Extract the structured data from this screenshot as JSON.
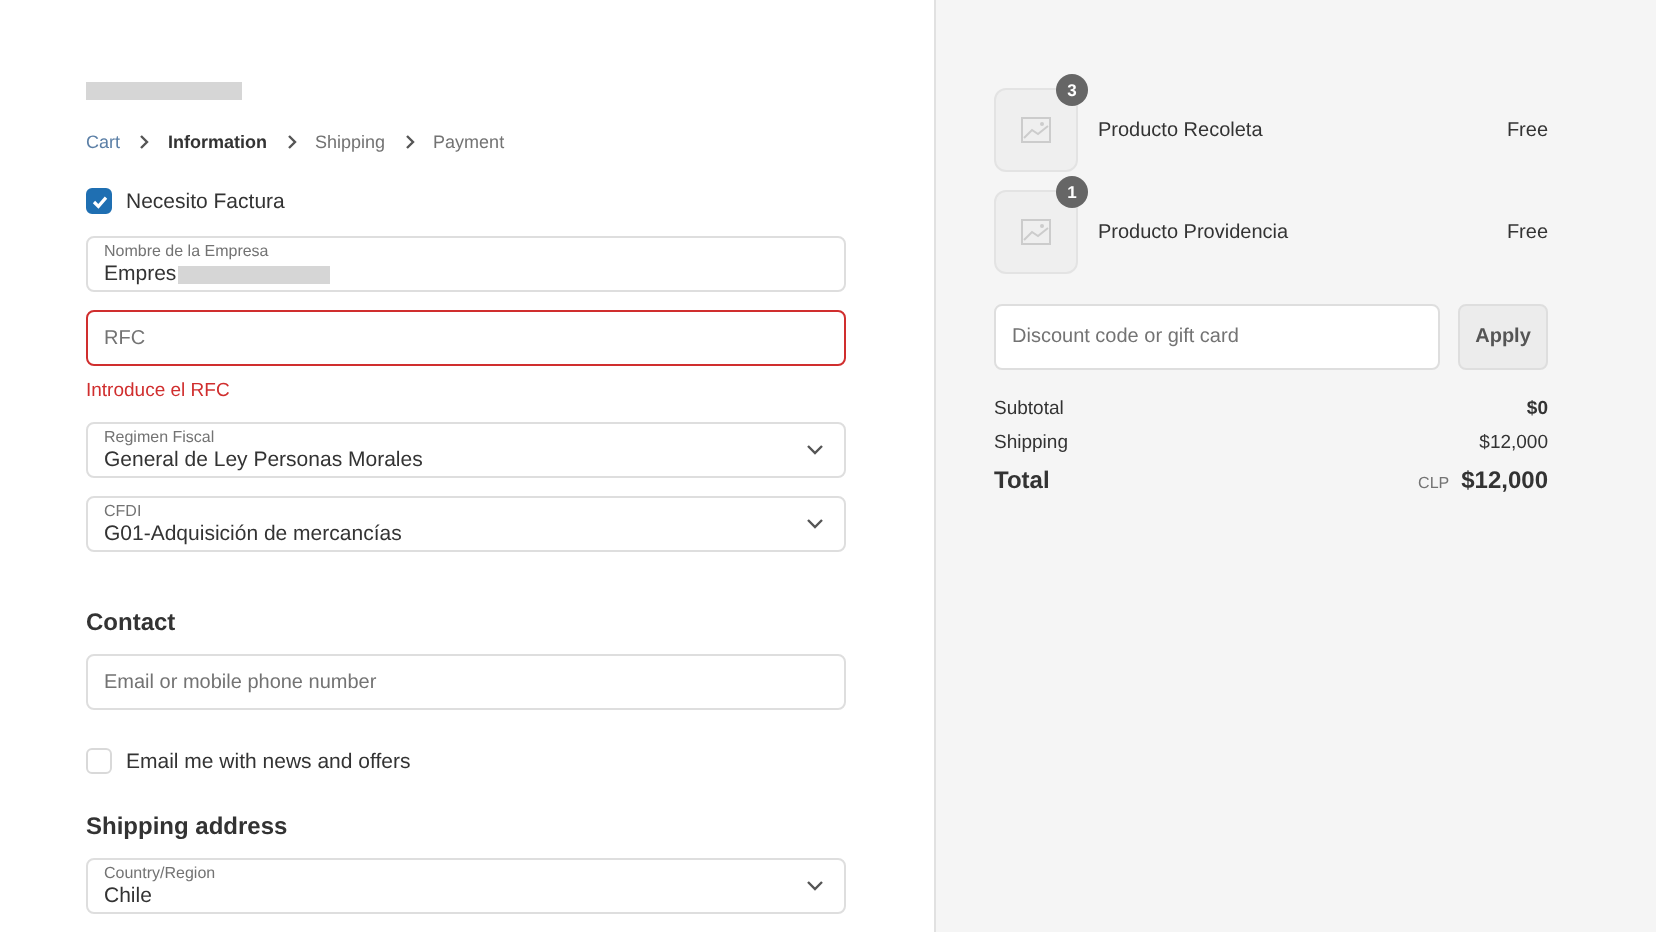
{
  "breadcrumb": [
    {
      "label": "Cart",
      "selected": false,
      "completed": true
    },
    {
      "label": "Information",
      "selected": true,
      "completed": false
    },
    {
      "label": "Shipping",
      "selected": false,
      "completed": false
    },
    {
      "label": "Payment",
      "selected": false,
      "completed": false
    }
  ],
  "invoice_checkbox": {
    "label": "Necesito Factura",
    "checked": true
  },
  "invoice_fields": [
    {
      "kind": "text",
      "label": "Nombre de la Empresa",
      "value": "Empres",
      "redacted": true,
      "invalid": false
    },
    {
      "kind": "text",
      "placeholder": "RFC",
      "invalid": true,
      "error": "Introduce el RFC"
    },
    {
      "kind": "select",
      "label": "Regimen Fiscal",
      "value": "General de Ley Personas Morales",
      "invalid": false
    },
    {
      "kind": "select",
      "label": "CFDI",
      "value": "G01-Adquisición de mercancías",
      "invalid": false
    }
  ],
  "contact": {
    "heading": "Contact",
    "field": {
      "placeholder": "Email or mobile phone number",
      "invalid": false
    },
    "newsletter": {
      "label": "Email me with news and offers",
      "checked": false
    }
  },
  "shipping_address": {
    "heading": "Shipping address",
    "field": {
      "kind": "select",
      "label": "Country/Region",
      "value": "Chile",
      "invalid": false
    }
  },
  "order_items": [
    {
      "name": "Producto Recoleta",
      "quantity": "3",
      "price": "Free"
    },
    {
      "name": "Producto Providencia",
      "quantity": "1",
      "price": "Free"
    }
  ],
  "discount": {
    "placeholder": "Discount code or gift card",
    "button": "Apply"
  },
  "summary": [
    {
      "label": "Subtotal",
      "value": "$0",
      "kind": "line",
      "bold_value": true
    },
    {
      "label": "Shipping",
      "value": "$12,000",
      "kind": "line",
      "bold_value": false
    },
    {
      "label": "Total",
      "currency": "CLP",
      "value": "$12,000",
      "kind": "total"
    }
  ]
}
